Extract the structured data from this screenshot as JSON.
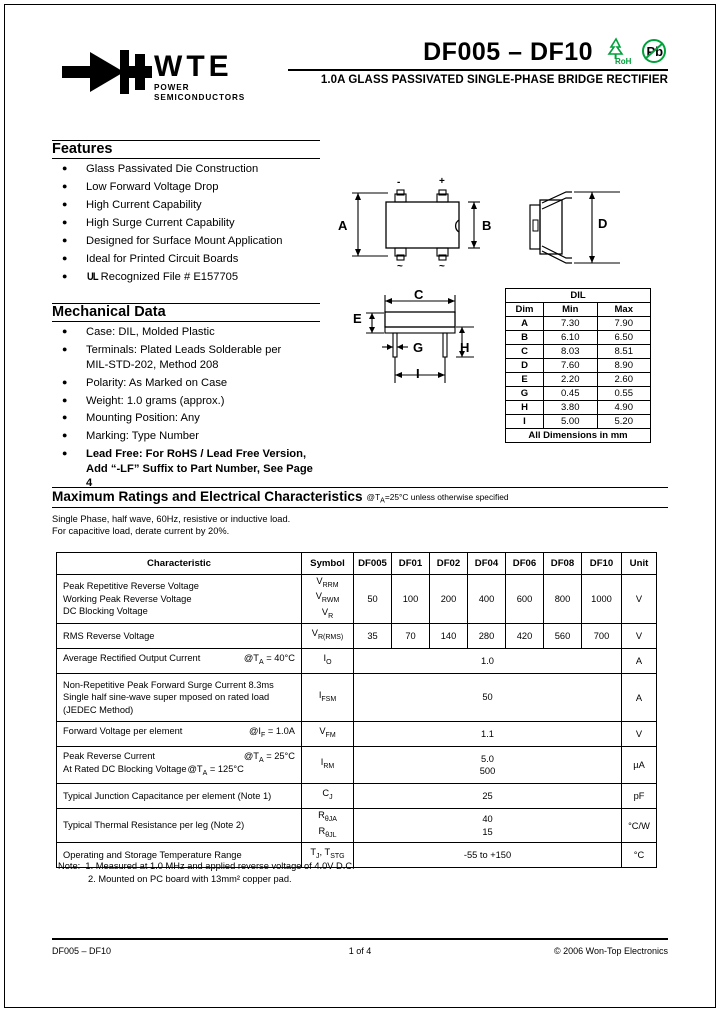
{
  "header": {
    "logo_brand": "WTE",
    "logo_tagline": "POWER SEMICONDUCTORS",
    "logo_icon": "diode-symbol",
    "title": "DF005 – DF10",
    "rohs_label": "RoHS",
    "pbfree_label": "Pb",
    "subtitle": "1.0A GLASS PASSIVATED SINGLE-PHASE BRIDGE RECTIFIER"
  },
  "features": {
    "title": "Features",
    "items": [
      "Glass Passivated Die Construction",
      "Low Forward Voltage Drop",
      "High Current Capability",
      "High Surge Current Capability",
      "Designed for Surface Mount Application",
      "Ideal for Printed Circuit Boards"
    ],
    "ul_item": "Recognized File # E157705",
    "ul_mark": "UL"
  },
  "mechanical": {
    "title": "Mechanical Data",
    "items": [
      {
        "text": "Case: DIL, Molded Plastic",
        "bold": false
      },
      {
        "text": "Terminals: Plated Leads Solderable per",
        "bold": false
      },
      {
        "text": "MIL-STD-202, Method 208",
        "bold": false,
        "cont": true
      },
      {
        "text": "Polarity: As Marked on Case",
        "bold": false
      },
      {
        "text": "Weight: 1.0 grams (approx.)",
        "bold": false
      },
      {
        "text": "Mounting Position: Any",
        "bold": false
      },
      {
        "text": "Marking: Type Number",
        "bold": false
      },
      {
        "text": "Lead Free: For RoHS / Lead Free Version,",
        "bold": true
      },
      {
        "text": "Add “-LF” Suffix to Part Number, See Page 4",
        "bold": true,
        "cont": true
      }
    ]
  },
  "drawings": {
    "top_view": {
      "dim_a": "A",
      "dim_b": "B",
      "pin_minus": "-",
      "pin_plus": "+",
      "pin_ac1": "~",
      "pin_ac2": "~"
    },
    "side_view": {
      "dim_d": "D"
    },
    "front_view": {
      "dim_c": "C",
      "dim_e": "E",
      "dim_g": "G",
      "dim_h": "H",
      "dim_i": "I"
    }
  },
  "dil_table": {
    "title": "DIL",
    "columns": [
      "Dim",
      "Min",
      "Max"
    ],
    "rows": [
      [
        "A",
        "7.30",
        "7.90"
      ],
      [
        "B",
        "6.10",
        "6.50"
      ],
      [
        "C",
        "8.03",
        "8.51"
      ],
      [
        "D",
        "7.60",
        "8.90"
      ],
      [
        "E",
        "2.20",
        "2.60"
      ],
      [
        "G",
        "0.45",
        "0.55"
      ],
      [
        "H",
        "3.80",
        "4.90"
      ],
      [
        "I",
        "5.00",
        "5.20"
      ]
    ],
    "footer": "All Dimensions in mm"
  },
  "ratings": {
    "title": "Maximum Ratings and Electrical Characteristics",
    "condition": "@TA=25°C unless otherwise specified",
    "note_line1": "Single Phase, half wave, 60Hz, resistive or inductive load.",
    "note_line2": "For capacitive load, derate current by 20%.",
    "columns": [
      "Characteristic",
      "Symbol",
      "DF005",
      "DF01",
      "DF02",
      "DF04",
      "DF06",
      "DF08",
      "DF10",
      "Unit"
    ],
    "rows": [
      {
        "characteristic": [
          "Peak Repetitive Reverse Voltage",
          "Working Peak Reverse Voltage",
          "DC Blocking Voltage"
        ],
        "symbol": [
          "VRRM",
          "VRWM",
          "VR"
        ],
        "values": [
          "50",
          "100",
          "200",
          "400",
          "600",
          "800",
          "1000"
        ],
        "span": false,
        "unit": "V"
      },
      {
        "characteristic": [
          "RMS Reverse Voltage"
        ],
        "symbol": [
          "VR(RMS)"
        ],
        "values": [
          "35",
          "70",
          "140",
          "280",
          "420",
          "560",
          "700"
        ],
        "span": false,
        "unit": "V"
      },
      {
        "characteristic": [
          "Average Rectified Output Current"
        ],
        "cond": "@TA = 40°C",
        "symbol": [
          "IO"
        ],
        "values": [
          "1.0"
        ],
        "span": true,
        "unit": "A"
      },
      {
        "characteristic": [
          "Non-Repetitive Peak Forward Surge Current 8.3ms",
          "Single half sine-wave super mposed on rated load",
          "(JEDEC Method)"
        ],
        "symbol": [
          "IFSM"
        ],
        "values": [
          "50"
        ],
        "span": true,
        "unit": "A"
      },
      {
        "characteristic": [
          "Forward Voltage per element"
        ],
        "cond": "@IF = 1.0A",
        "symbol": [
          "VFM"
        ],
        "values": [
          "1.1"
        ],
        "span": true,
        "unit": "V"
      },
      {
        "characteristic": [
          "Peak Reverse Current",
          "At Rated DC Blocking Voltage"
        ],
        "cond2": [
          "@TA = 25°C",
          "@TA = 125°C"
        ],
        "symbol": [
          "IRM"
        ],
        "values": [
          "5.0",
          "500"
        ],
        "span": true,
        "unit": "µA"
      },
      {
        "characteristic": [
          "Typical Junction Capacitance per element (Note 1)"
        ],
        "symbol": [
          "CJ"
        ],
        "values": [
          "25"
        ],
        "span": true,
        "unit": "pF"
      },
      {
        "characteristic": [
          "Typical Thermal Resistance per leg (Note 2)"
        ],
        "symbol": [
          "RθJA",
          "RθJL"
        ],
        "values": [
          "40",
          "15"
        ],
        "span": true,
        "unit": "°C/W"
      },
      {
        "characteristic": [
          "Operating and Storage Temperature Range"
        ],
        "symbol": [
          "TJ, TSTG"
        ],
        "values": [
          "-55 to +150"
        ],
        "span": true,
        "unit": "°C"
      }
    ]
  },
  "notes": {
    "label": "Note:",
    "note1": "1. Measured at 1.0 MHz and applied reverse voltage of 4.0V D.C.",
    "note2": "2. Mounted on PC board with 13mm² copper pad."
  },
  "footer": {
    "left": "DF005 – DF10",
    "center": "1 of 4",
    "right": "© 2006 Won-Top Electronics"
  },
  "colors": {
    "green": "#00a13a",
    "black": "#000000",
    "background": "#ffffff"
  }
}
